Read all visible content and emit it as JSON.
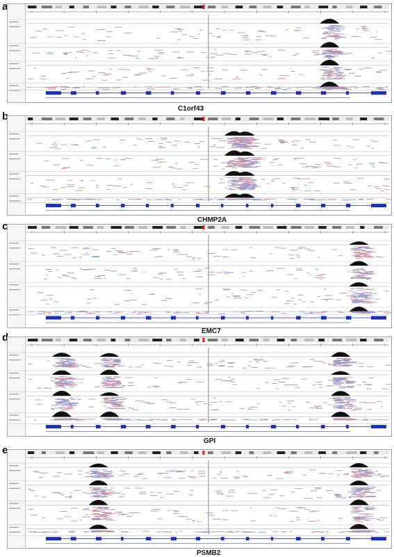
{
  "panels": [
    {
      "letter": "a",
      "gene": "C1orf43"
    },
    {
      "letter": "b",
      "gene": "CHMP2A"
    },
    {
      "letter": "c",
      "gene": "EMC7"
    },
    {
      "letter": "d",
      "gene": "GPI"
    },
    {
      "letter": "e",
      "gene": "PSMB2"
    }
  ],
  "colors": {
    "coverage": "#111111",
    "read_forward": "#d08a9a",
    "read_reverse": "#8a9ad0",
    "gene_model": "#1a2fb8",
    "ideogram": "#222222",
    "border": "#9a9a9a"
  }
}
